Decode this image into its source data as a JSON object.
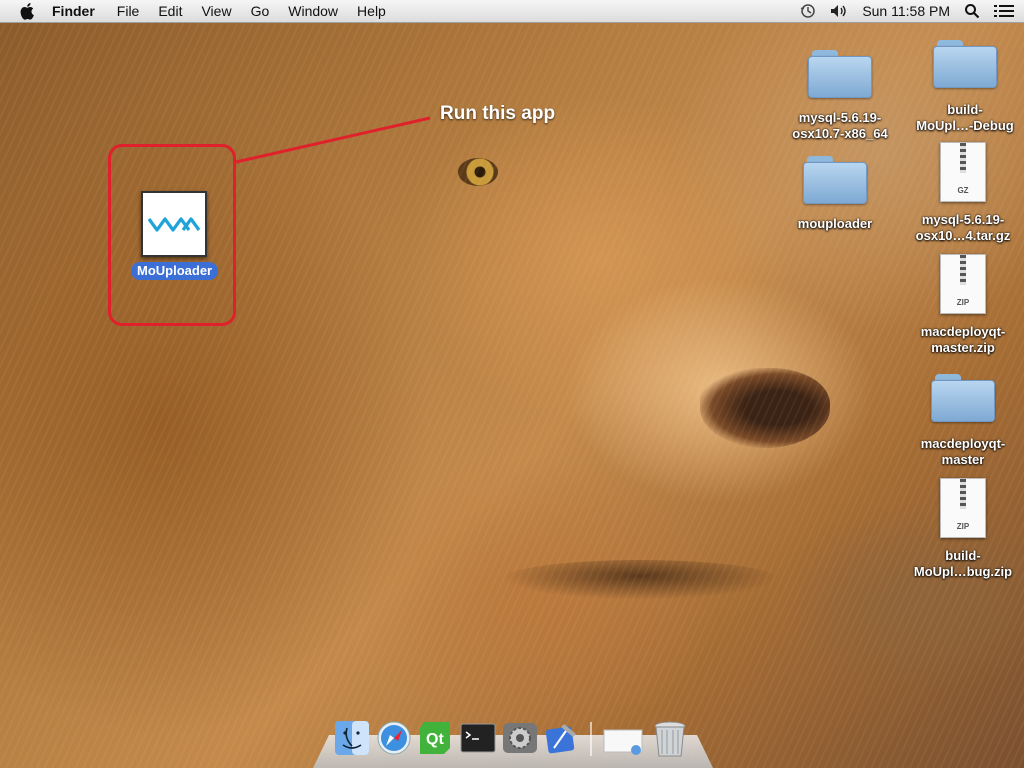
{
  "menubar": {
    "app_name": "Finder",
    "menus": [
      "File",
      "Edit",
      "View",
      "Go",
      "Window",
      "Help"
    ],
    "clock": "Sun 11:58 PM",
    "status_icons": [
      "time-machine-icon",
      "volume-icon",
      "spotlight-search-icon",
      "notification-list-icon"
    ]
  },
  "annotation": {
    "text": "Run this app"
  },
  "selected_app": {
    "name": "MoUploader",
    "icon": "wave-logo-icon"
  },
  "desktop_items": [
    {
      "label": "mysql-5.6.19-\nosx10.7-x86_64",
      "kind": "folder"
    },
    {
      "label": "build-\nMoUpl…-Debug",
      "kind": "folder"
    },
    {
      "label": "mouploader",
      "kind": "folder"
    },
    {
      "label": "mysql-5.6.19-\nosx10…4.tar.gz",
      "kind": "archive",
      "badge": "GZ"
    },
    {
      "label": "macdeployqt-\nmaster.zip",
      "kind": "archive",
      "badge": "ZIP"
    },
    {
      "label": "macdeployqt-\nmaster",
      "kind": "folder"
    },
    {
      "label": "build-\nMoUpl…bug.zip",
      "kind": "archive",
      "badge": "ZIP"
    }
  ],
  "dock": {
    "items": [
      "finder-icon",
      "safari-icon",
      "qt-creator-icon",
      "terminal-icon",
      "system-preferences-icon",
      "xcode-icon"
    ],
    "right_items": [
      "downloads-stack-icon",
      "trash-icon"
    ],
    "qt_badge": "Qt"
  },
  "colors": {
    "annotation_red": "#e0202a",
    "selection_blue": "#3c6fd6",
    "folder_blue": "#8fb8dd"
  }
}
